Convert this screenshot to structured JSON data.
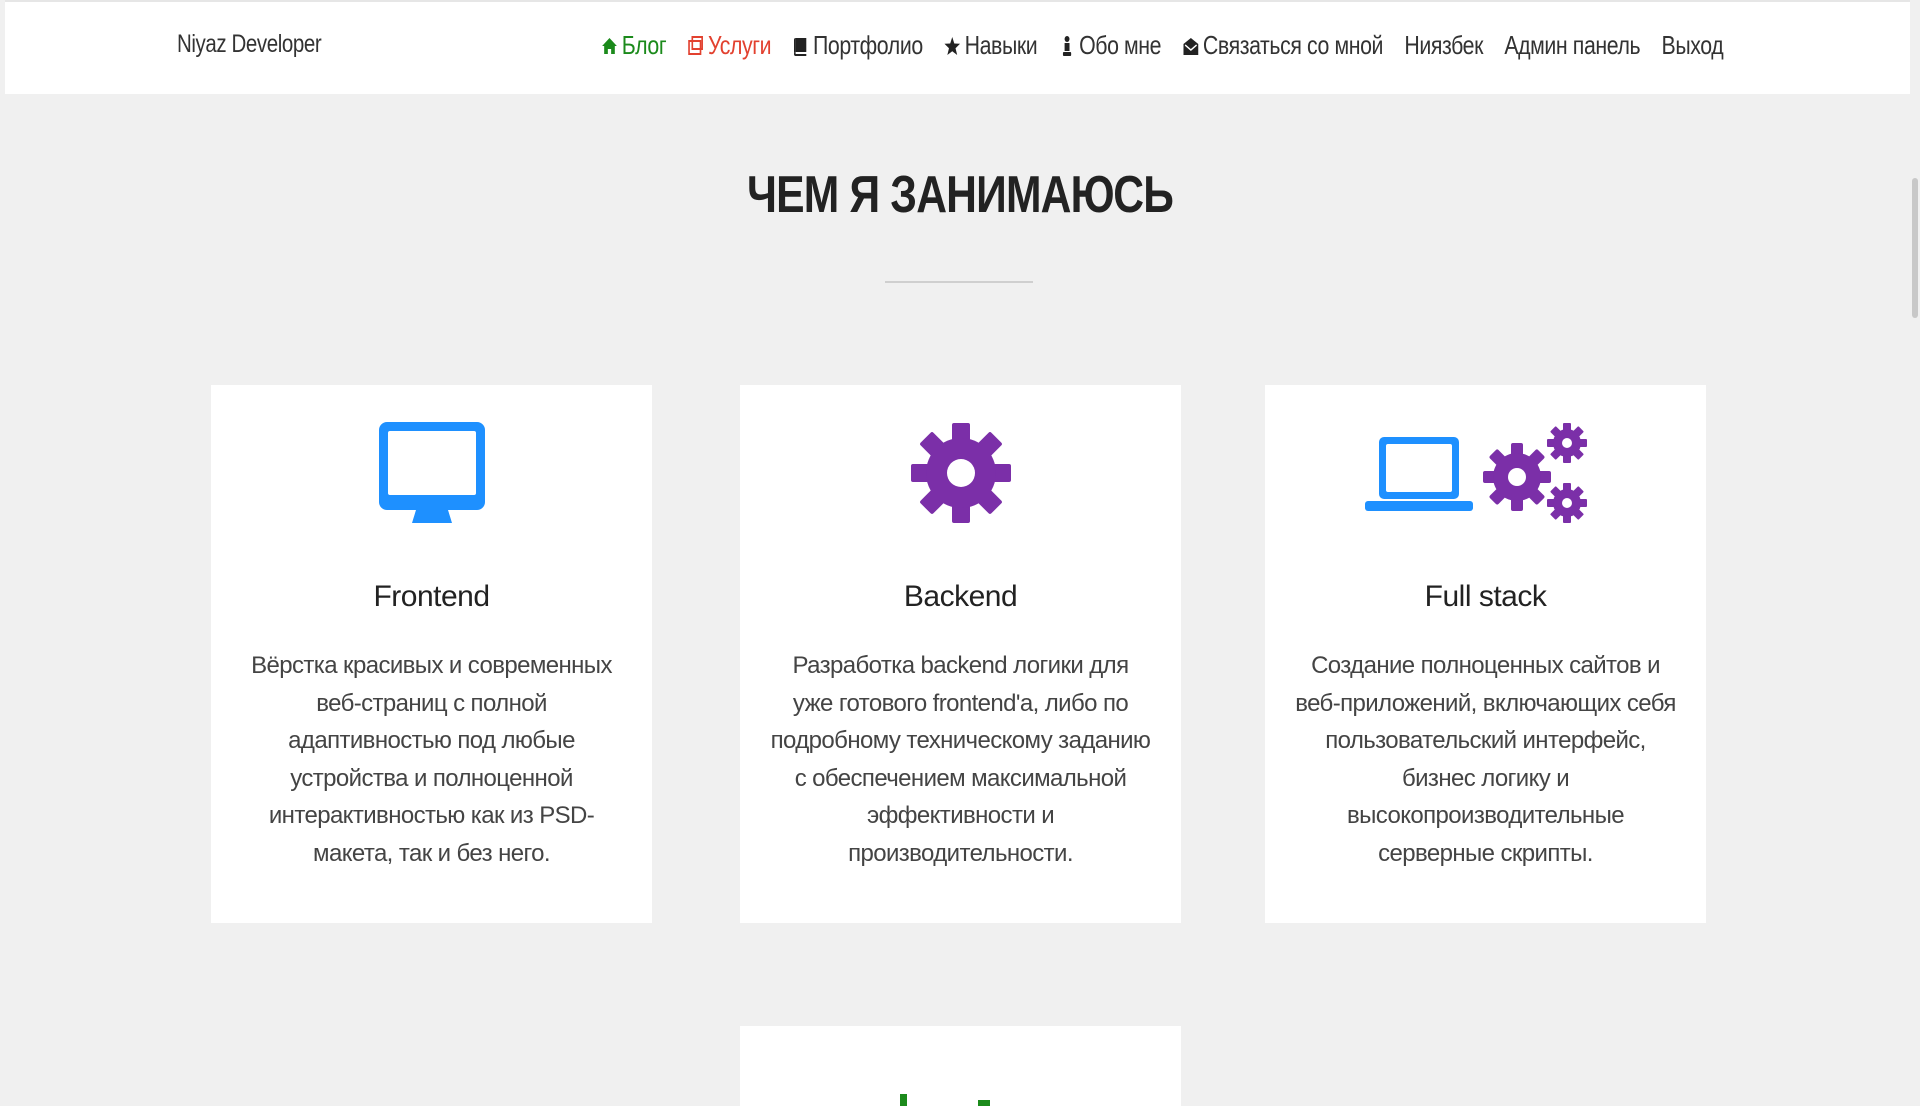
{
  "header": {
    "brand": "Niyaz Developer",
    "nav": [
      {
        "label": "Блог",
        "icon": "home-icon",
        "color": "#1b8a1b"
      },
      {
        "label": "Услуги",
        "icon": "services-icon",
        "color": "#e2412f"
      },
      {
        "label": "Портфолио",
        "icon": "book-icon",
        "color": "#333333"
      },
      {
        "label": "Навыки",
        "icon": "star-icon",
        "color": "#333333"
      },
      {
        "label": "Обо мне",
        "icon": "person-icon",
        "color": "#333333"
      },
      {
        "label": "Связаться со мной",
        "icon": "envelope-icon",
        "color": "#333333"
      },
      {
        "label": "Ниязбек",
        "icon": "",
        "color": "#333333"
      },
      {
        "label": "Админ панель",
        "icon": "",
        "color": "#333333"
      },
      {
        "label": "Выход",
        "icon": "",
        "color": "#333333"
      }
    ]
  },
  "section": {
    "title": "ЧЕМ Я ЗАНИМАЮСЬ"
  },
  "cards": [
    {
      "title": "Frontend",
      "icon": "monitor-icon",
      "text": "Вёрстка красивых и современных веб-страниц с полной адаптивностью под любые устройства и полноценной интерактивностью как из PSD-макета, так и без него."
    },
    {
      "title": "Backend",
      "icon": "gear-icon",
      "text": "Разработка backend логики для уже готового frontend'a, либо по подробному техническому заданию с обеспечением максимальной эффективности и производительности."
    },
    {
      "title": "Full stack",
      "icon": "laptop-gears-icon",
      "text": "Создание полноценных сайтов и веб-приложений, включающих себя пользовательский интерфейс, бизнес логику и высокопроизводительные серверные скрипты."
    }
  ],
  "colors": {
    "accent_blue": "#1e90ff",
    "accent_purple": "#7b2fa8",
    "nav_active_green": "#1b8a1b",
    "nav_active_red": "#e2412f",
    "partial_icon_green": "#1b8a1b"
  }
}
